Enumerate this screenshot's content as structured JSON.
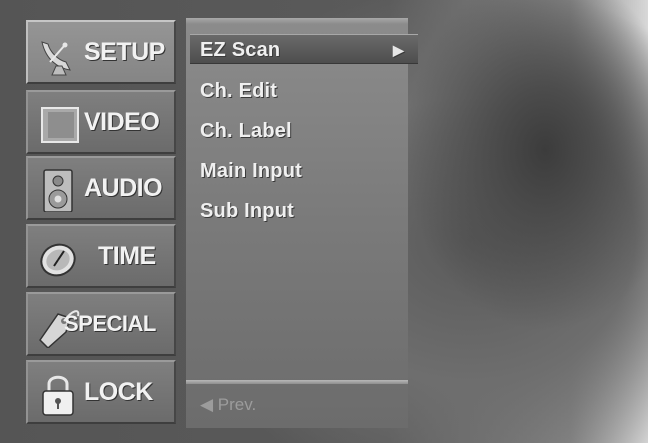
{
  "sidebar": {
    "items": [
      {
        "label": "SETUP",
        "icon": "satellite-dish-icon"
      },
      {
        "label": "VIDEO",
        "icon": "screen-icon"
      },
      {
        "label": "AUDIO",
        "icon": "speaker-icon"
      },
      {
        "label": "TIME",
        "icon": "clock-icon"
      },
      {
        "label": "SPECIAL",
        "icon": "tag-icon"
      },
      {
        "label": "LOCK",
        "icon": "padlock-icon"
      }
    ],
    "active": "SETUP"
  },
  "submenu": {
    "items": [
      {
        "label": "EZ Scan",
        "arrow": "▶"
      },
      {
        "label": "Ch. Edit"
      },
      {
        "label": "Ch. Label"
      },
      {
        "label": "Main Input"
      },
      {
        "label": "Sub Input"
      }
    ],
    "selected": "EZ Scan",
    "prev_label": "◀ Prev."
  },
  "colors": {
    "panel": "#808080",
    "highlight": "#555555",
    "text": "#f0f0f0",
    "prev_text": "#9c9c9c"
  }
}
